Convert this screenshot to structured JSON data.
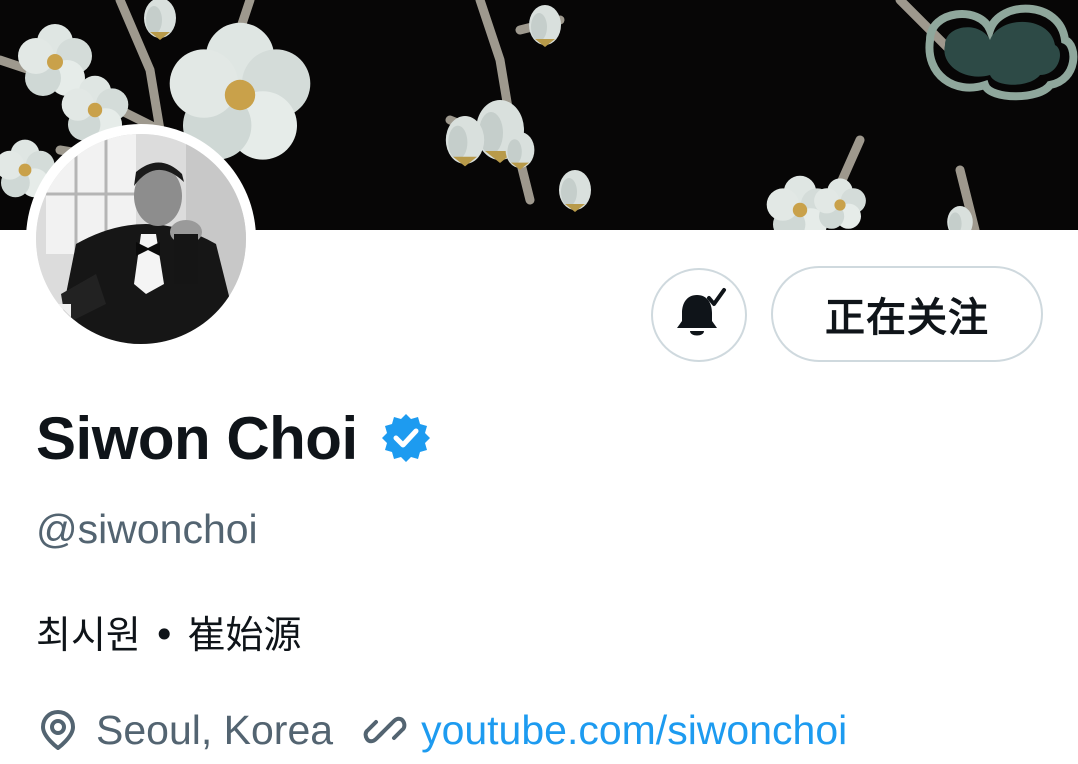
{
  "header": {
    "banner_image": "mother-of-pearl plum blossoms on black lacquer",
    "avatar_image": "black-and-white portrait in tuxedo"
  },
  "actions": {
    "bell_icon": "bell-check-icon",
    "follow_label": "正在关注"
  },
  "profile": {
    "display_name": "Siwon Choi",
    "verified_icon": "verified-badge-icon",
    "handle": "@siwonchoi",
    "bio": "최시원 • 崔始源",
    "location_icon": "location-pin-icon",
    "location": "Seoul, Korea",
    "link_icon": "link-icon",
    "website": "youtube.com/siwonchoi"
  },
  "colors": {
    "text_primary": "#0f1419",
    "text_secondary": "#536471",
    "link": "#1d9bf0",
    "verified": "#1d9bf0",
    "border": "#cfd9de"
  }
}
